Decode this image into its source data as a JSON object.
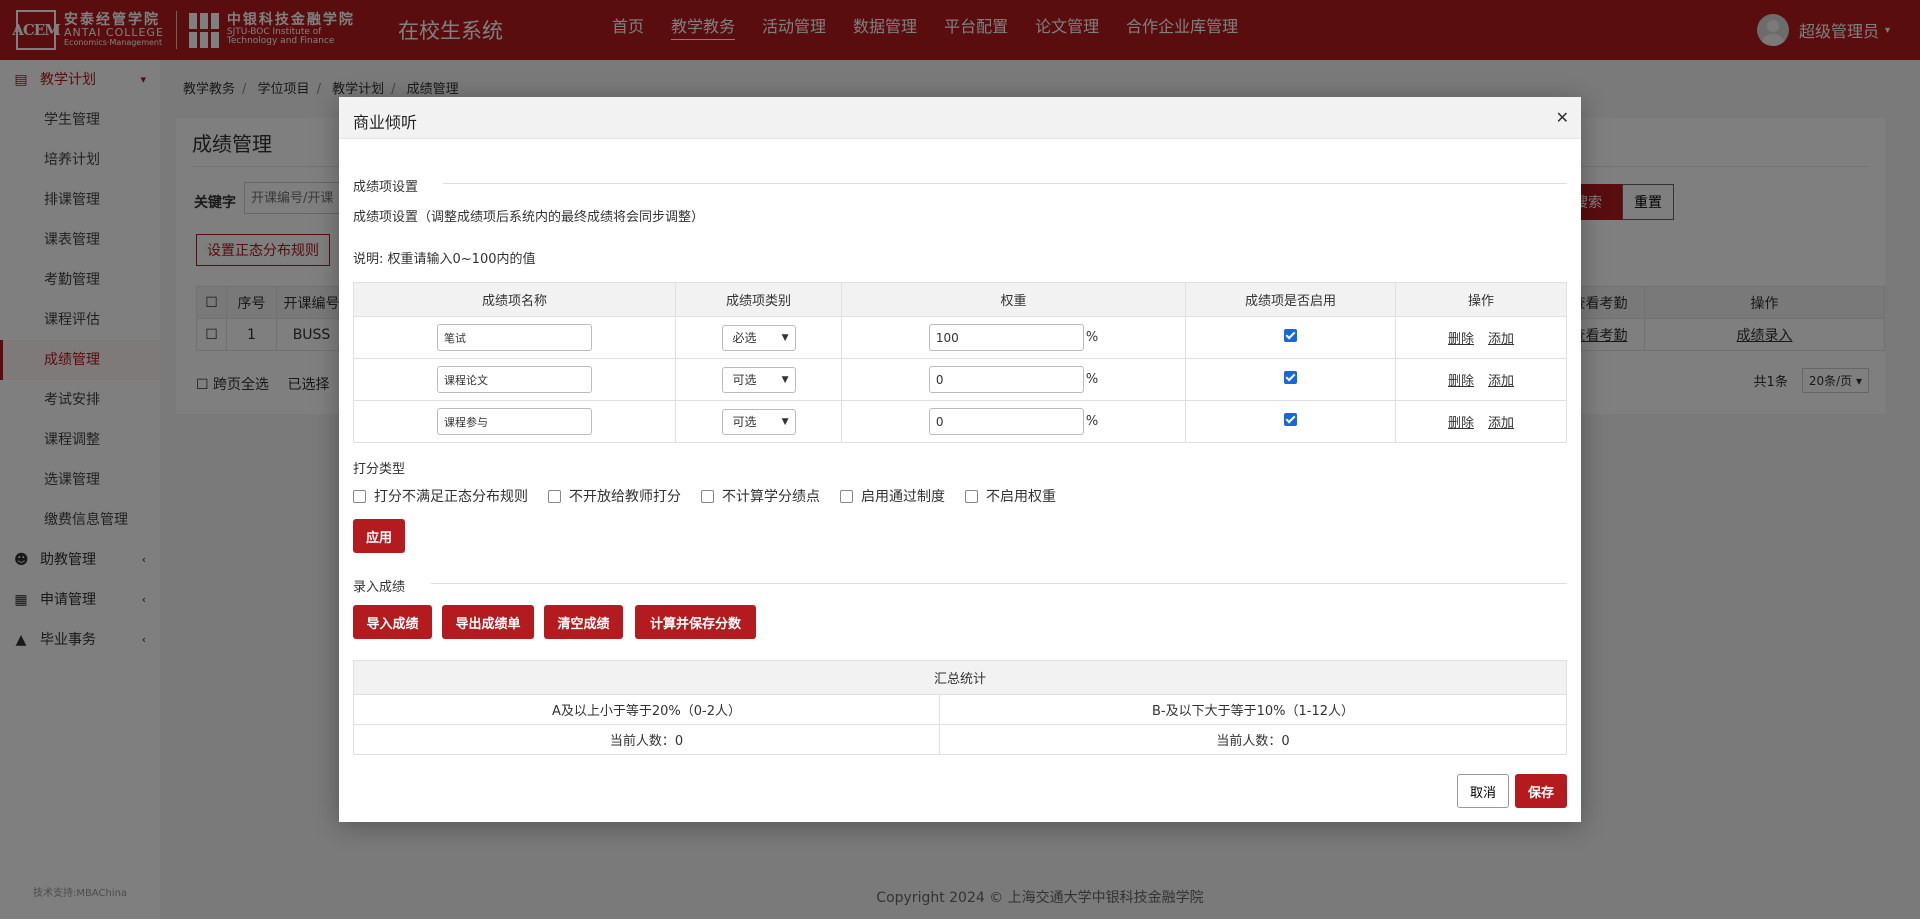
{
  "header": {
    "logo1": {
      "mark": "ACEM",
      "cn": "安泰经管学院",
      "en1": "ANTAI COLLEGE",
      "en2": "Economics·Management"
    },
    "logo2": {
      "cn": "中银科技金融学院",
      "en1": "SJTU-BOC Institute of",
      "en2": "Technology and Finance"
    },
    "system_name": "在校生系统",
    "nav": [
      "首页",
      "教学教务",
      "活动管理",
      "数据管理",
      "平台配置",
      "论文管理",
      "合作企业库管理"
    ],
    "user": "超级管理员"
  },
  "sidebar": {
    "group_active": "教学计划",
    "items": [
      "学生管理",
      "培养计划",
      "排课管理",
      "课表管理",
      "考勤管理",
      "课程评估",
      "成绩管理",
      "考试安排",
      "课程调整",
      "选课管理",
      "缴费信息管理"
    ],
    "groups": [
      "助教管理",
      "申请管理",
      "毕业事务"
    ],
    "footer": "技术支持:MBAChina"
  },
  "breadcrumb": [
    "教学教务",
    "学位项目",
    "教学计划",
    "成绩管理"
  ],
  "page": {
    "title": "成绩管理",
    "keyword_label": "关键字",
    "keyword_placeholder": "开课编号/开课",
    "search_label": "搜索",
    "reset_label": "重置",
    "normal_rule_label": "设置正态分布规则",
    "table_headers": [
      "序号",
      "开课编号",
      "查看考勤",
      "操作"
    ],
    "row": {
      "index": "1",
      "code": "BUSS",
      "attendance": "查看考勤",
      "action": "成绩录入"
    },
    "select_all": "跨页全选",
    "selected": "已选择",
    "total": "共1条",
    "page_size": "20条/页"
  },
  "copyright": "Copyright 2024 © 上海交通大学中银科技金融学院",
  "modal": {
    "title": "商业倾听",
    "section_items": "成绩项设置",
    "items_note": "成绩项设置（调整成绩项后系统内的最终成绩将会同步调整）",
    "weight_note": "说明: 权重请输入0~100内的值",
    "headers": [
      "成绩项名称",
      "成绩项类别",
      "权重",
      "成绩项是否启用",
      "操作"
    ],
    "rows": [
      {
        "name": "笔试",
        "type": "必选",
        "weight": "100",
        "enabled": true
      },
      {
        "name": "课程论文",
        "type": "可选",
        "weight": "0",
        "enabled": true
      },
      {
        "name": "课程参与",
        "type": "可选",
        "weight": "0",
        "enabled": true
      }
    ],
    "pct": "%",
    "op_delete": "删除",
    "op_add": "添加",
    "score_type_label": "打分类型",
    "options": [
      "打分不满足正态分布规则",
      "不开放给教师打分",
      "不计算学分绩点",
      "启用通过制度",
      "不启用权重"
    ],
    "apply_label": "应用",
    "section_entry": "录入成绩",
    "entry_buttons": [
      "导入成绩",
      "导出成绩单",
      "清空成绩",
      "计算并保存分数"
    ],
    "summary": {
      "title": "汇总统计",
      "col_a": "A及以上小于等于20%（0-2人）",
      "col_b": "B-及以下大于等于10%（1-12人）",
      "count_a": "当前人数：0",
      "count_b": "当前人数：0"
    },
    "cancel_label": "取消",
    "save_label": "保存"
  }
}
